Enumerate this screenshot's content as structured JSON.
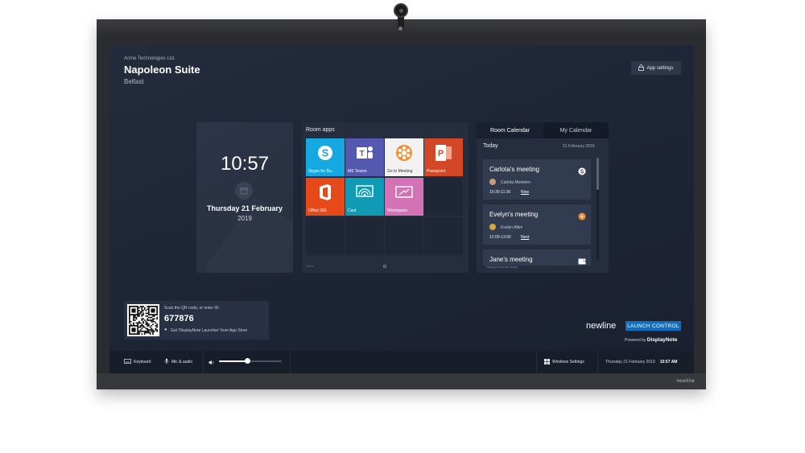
{
  "device": {
    "brand_label": "newline"
  },
  "header": {
    "company": "Acme Technologies Ltd.",
    "room_name": "Napoleon Suite",
    "location": "Belfast",
    "app_settings_label": "App settings"
  },
  "clock": {
    "time": "10:57",
    "date": "Thursday 21 February",
    "year": "2019"
  },
  "room_apps": {
    "title": "Room apps",
    "apps": [
      {
        "label": "Skype for Bu...",
        "icon": "skype-icon",
        "color": "#16a8e0"
      },
      {
        "label": "MS Teams",
        "icon": "teams-icon",
        "color": "#5558af"
      },
      {
        "label": "Go to Meeting",
        "icon": "gotomeeting-icon",
        "color": "#f2f2f2"
      },
      {
        "label": "Powepoint",
        "icon": "powerpoint-icon",
        "color": "#d24726"
      },
      {
        "label": "Office 365",
        "icon": "office365-icon",
        "color": "#e64a19"
      },
      {
        "label": "Cast",
        "icon": "cast-icon",
        "color": "#0f9bb3"
      },
      {
        "label": "Workspace",
        "icon": "workspace-icon",
        "color": "#d373b6"
      }
    ],
    "pager": "1 of 1"
  },
  "calendar": {
    "tabs": [
      "Room Calendar",
      "My Calendar"
    ],
    "active_tab": "Room Calendar",
    "day_label": "Today",
    "date": "21 February 2019",
    "meetings": [
      {
        "title": "Carlota's meeting",
        "organizer": "Carlota Monteiro",
        "time": "10:30-11:30",
        "status": "Now",
        "icon": "skype-icon"
      },
      {
        "title": "Evelyn's meeting",
        "organizer": "Evelyn Allen",
        "time": "12:00-13:00",
        "status": "Next",
        "icon": "gotomeeting-icon"
      },
      {
        "title": "Jane's meeting",
        "icon": "teams-icon"
      }
    ],
    "listing": "Listing 8 events today"
  },
  "join": {
    "scan_label": "Scan the QR code, or enter ID:",
    "id": "677876",
    "store_text": "Get 'DisplayNote Launcher' from App Store"
  },
  "branding": {
    "newline": "newline",
    "launch": "LAUNCH CONTROL",
    "powered_by": "Powered by",
    "displaynote": "DisplayNote"
  },
  "taskbar": {
    "keyboard": "Keyboard",
    "mic_audio": "Mic & audio",
    "volume_percent": 45,
    "windows_settings": "Windows Settings",
    "date": "Thursday 21 February 2019",
    "time": "10:57 AM"
  }
}
